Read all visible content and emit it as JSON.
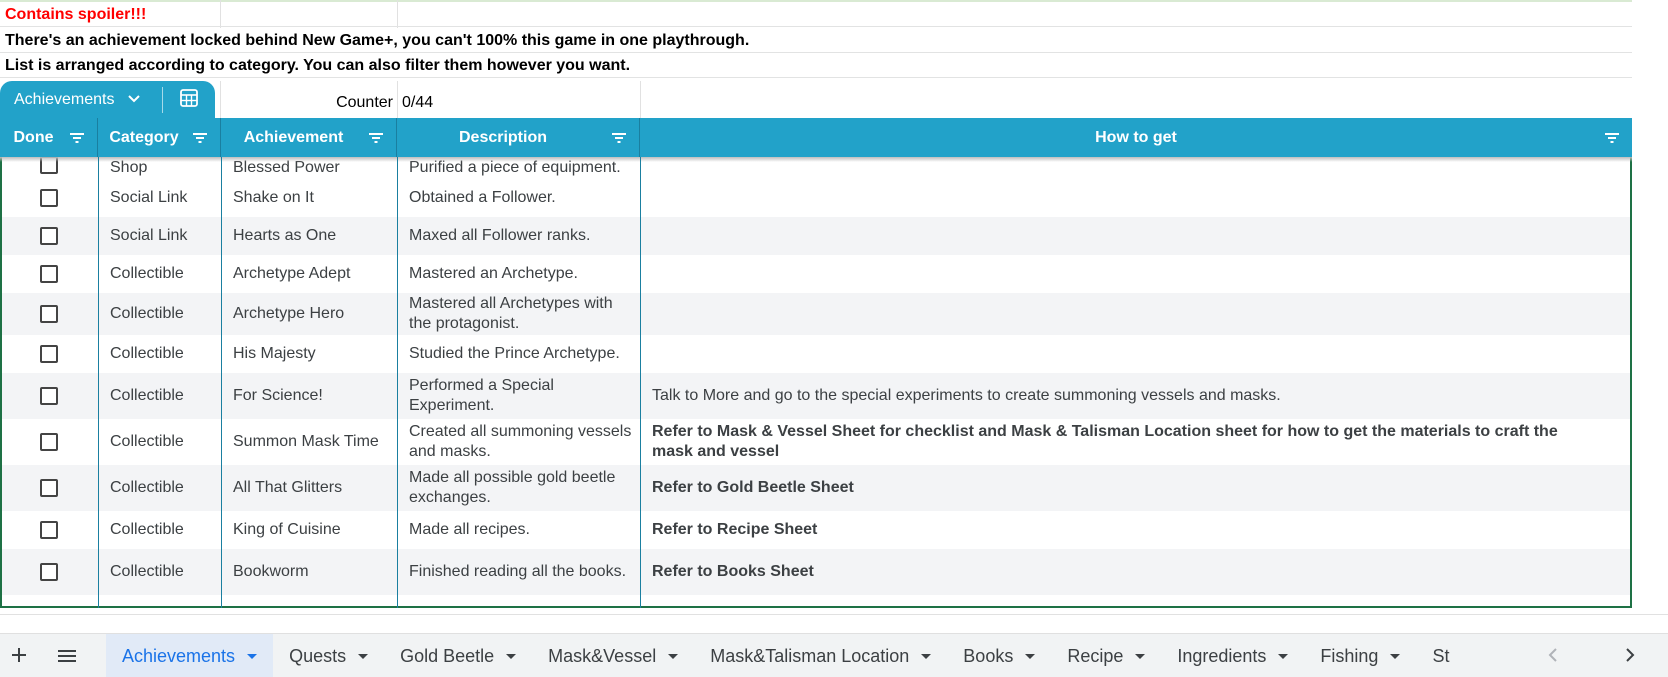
{
  "notes": {
    "spoiler": "Contains spoiler!!!",
    "newgame": "There's an achievement locked behind New Game+, you can't 100% this game in one playthrough.",
    "arranged": "List is arranged according to category. You can also filter them however you want."
  },
  "table_tab": {
    "label": "Achievements"
  },
  "counter": {
    "label": "Counter",
    "value": "0/44"
  },
  "headers": {
    "done": "Done",
    "category": "Category",
    "achievement": "Achievement",
    "description": "Description",
    "how": "How to get"
  },
  "rows": [
    {
      "category": "Shop",
      "achievement": "Blessed Power",
      "description": "Purified a piece of equipment.",
      "how": "",
      "how_bold": false,
      "done": false
    },
    {
      "category": "Social Link",
      "achievement": "Shake on It",
      "description": "Obtained a Follower.",
      "how": "",
      "how_bold": false,
      "done": false
    },
    {
      "category": "Social Link",
      "achievement": "Hearts as One",
      "description": "Maxed all Follower ranks.",
      "how": "",
      "how_bold": false,
      "done": false
    },
    {
      "category": "Collectible",
      "achievement": "Archetype Adept",
      "description": "Mastered an Archetype.",
      "how": "",
      "how_bold": false,
      "done": false
    },
    {
      "category": "Collectible",
      "achievement": "Archetype Hero",
      "description": "Mastered all Archetypes with the protagonist.",
      "how": "",
      "how_bold": false,
      "done": false
    },
    {
      "category": "Collectible",
      "achievement": "His Majesty",
      "description": "Studied the Prince Archetype.",
      "how": "",
      "how_bold": false,
      "done": false
    },
    {
      "category": "Collectible",
      "achievement": "For Science!",
      "description": "Performed a Special Experiment.",
      "how": "Talk to More and go to the special experiments to create summoning vessels and masks.",
      "how_bold": false,
      "done": false
    },
    {
      "category": "Collectible",
      "achievement": "Summon Mask Time",
      "description": "Created all summoning vessels and masks.",
      "how": "Refer to Mask & Vessel Sheet for checklist and Mask & Talisman Location sheet for how to get the materials to craft the mask and vessel",
      "how_bold": true,
      "done": false
    },
    {
      "category": "Collectible",
      "achievement": "All That Glitters",
      "description": "Made all possible gold beetle exchanges.",
      "how": "Refer to Gold Beetle Sheet",
      "how_bold": true,
      "done": false
    },
    {
      "category": "Collectible",
      "achievement": "King of Cuisine",
      "description": "Made all recipes.",
      "how": "Refer to Recipe Sheet",
      "how_bold": true,
      "done": false
    },
    {
      "category": "Collectible",
      "achievement": "Bookworm",
      "description": "Finished reading all the books.",
      "how": "Refer to Books Sheet",
      "how_bold": true,
      "done": false
    }
  ],
  "sheet_tabs": [
    {
      "label": "Achievements",
      "active": true
    },
    {
      "label": "Quests",
      "active": false
    },
    {
      "label": "Gold Beetle",
      "active": false
    },
    {
      "label": "Mask&Vessel",
      "active": false
    },
    {
      "label": "Mask&Talisman Location",
      "active": false
    },
    {
      "label": "Books",
      "active": false
    },
    {
      "label": "Recipe",
      "active": false
    },
    {
      "label": "Ingredients",
      "active": false
    },
    {
      "label": "Fishing",
      "active": false
    },
    {
      "label": "St",
      "active": false
    }
  ],
  "colors": {
    "header_bg": "#22a2c9",
    "active_tab_text": "#1a73e8",
    "spoiler_text": "#ff0000",
    "table_border": "#1e7145"
  },
  "icons": {
    "add_sheet": "plus-icon",
    "all_sheets": "menu-icon",
    "calculator": "calculator-icon",
    "filter": "filter-icon"
  }
}
